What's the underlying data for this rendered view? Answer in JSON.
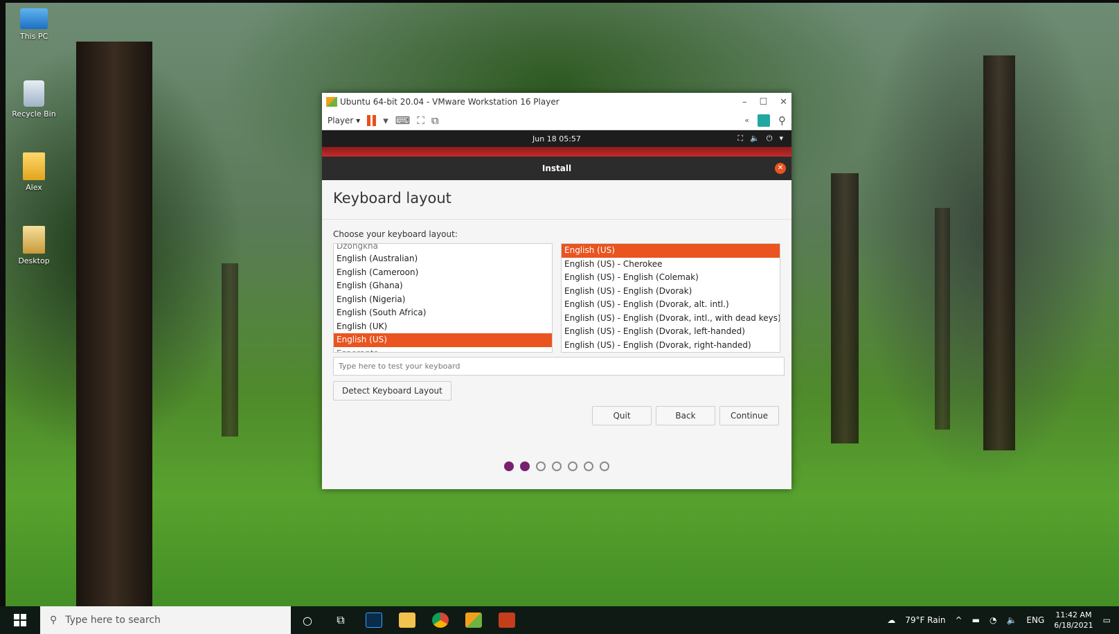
{
  "desktop": {
    "icons": [
      {
        "label": "This PC"
      },
      {
        "label": "Recycle Bin"
      },
      {
        "label": "Alex"
      },
      {
        "label": "Desktop"
      }
    ]
  },
  "vmware": {
    "title": "Ubuntu 64-bit 20.04 - VMware Workstation 16 Player",
    "player_menu": "Player"
  },
  "ubuntu": {
    "clock": "Jun 18  05:57",
    "installer_title": "Install",
    "page_title": "Keyboard layout",
    "choose_label": "Choose your keyboard layout:",
    "left_list": {
      "partial_top": "Dzongkha",
      "items": [
        "English (Australian)",
        "English (Cameroon)",
        "English (Ghana)",
        "English (Nigeria)",
        "English (South Africa)",
        "English (UK)",
        "English (US)"
      ],
      "selected": "English (US)",
      "partial_bottom": "Esperanto"
    },
    "right_list": {
      "items": [
        "English (US)",
        "English (US) - Cherokee",
        "English (US) - English (Colemak)",
        "English (US) - English (Dvorak)",
        "English (US) - English (Dvorak, alt. intl.)",
        "English (US) - English (Dvorak, intl., with dead keys)",
        "English (US) - English (Dvorak, left-handed)",
        "English (US) - English (Dvorak, right-handed)"
      ],
      "selected": "English (US)"
    },
    "test_placeholder": "Type here to test your keyboard",
    "detect_button": "Detect Keyboard Layout",
    "quit_button": "Quit",
    "back_button": "Back",
    "continue_button": "Continue",
    "progress": {
      "total": 7,
      "completed": 2
    }
  },
  "taskbar": {
    "search_placeholder": "Type here to search",
    "weather": "79°F  Rain",
    "language": "ENG",
    "time": "11:42 AM",
    "date": "6/18/2021"
  },
  "colors": {
    "ubuntu_orange": "#e95420",
    "ubuntu_aubergine": "#77216f",
    "topbar": "#1d1d1d"
  }
}
